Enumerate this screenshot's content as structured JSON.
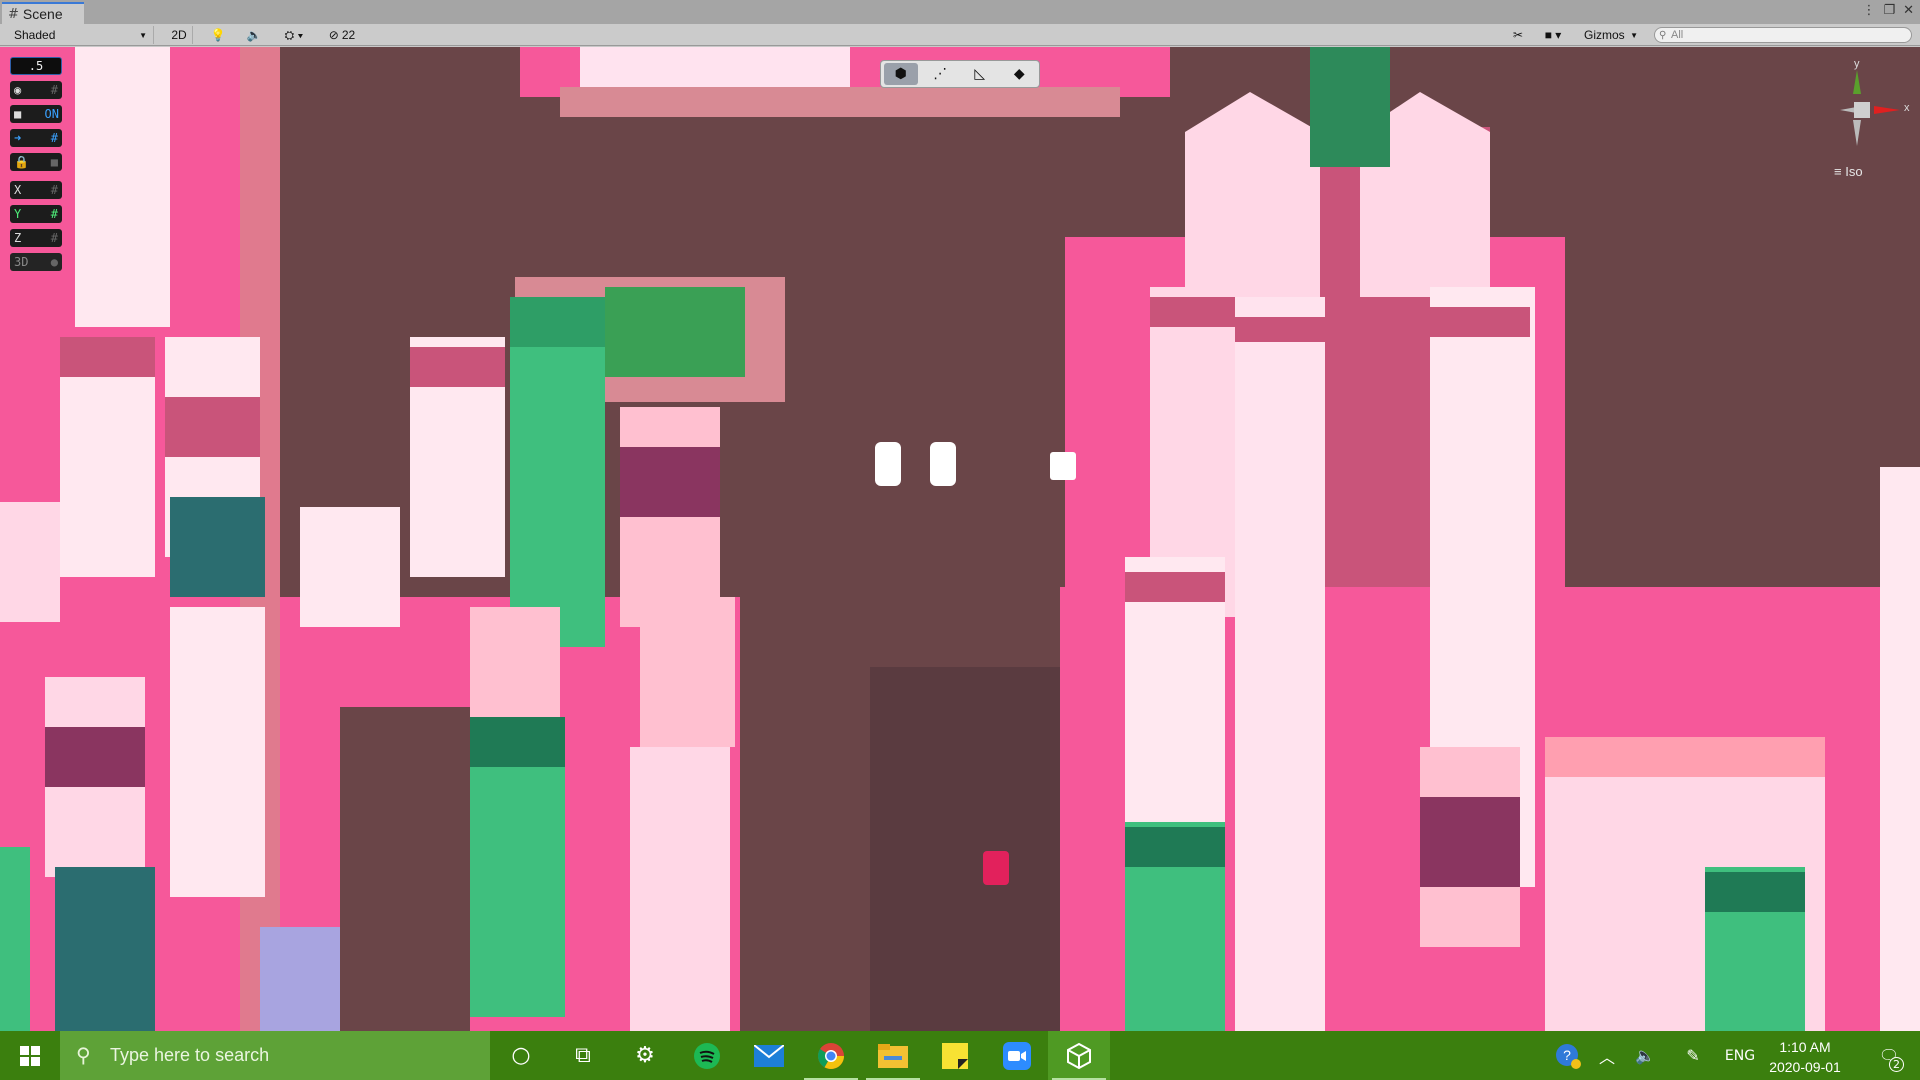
{
  "window": {
    "tab_title": "Scene",
    "controls": [
      "⁼",
      "□",
      "✕"
    ]
  },
  "toolbar": {
    "shading_mode": "Shaded",
    "btn_2d": "2D",
    "hidden_count": "22",
    "gizmos_label": "Gizmos",
    "search_placeholder": "All"
  },
  "overlay": {
    "snap_value": ".5",
    "on_label": "ON",
    "axis_x": "X",
    "axis_y": "Y",
    "axis_z": "Z",
    "label_3d": "3D"
  },
  "gizmo": {
    "y_label": "y",
    "x_label": "x",
    "projection": "Iso"
  },
  "taskbar": {
    "search_placeholder": "Type here to search",
    "language": "ENG",
    "time": "1:10 AM",
    "date": "2020-09-01",
    "notification_count": "2"
  },
  "colors": {
    "taskbar_bg": "#3b7f0e",
    "search_bg": "#5ea237",
    "street": "#6a4548",
    "hot_pink": "#f6589a",
    "light_pink": "#ffd7e6",
    "green": "#3fbf7e"
  }
}
